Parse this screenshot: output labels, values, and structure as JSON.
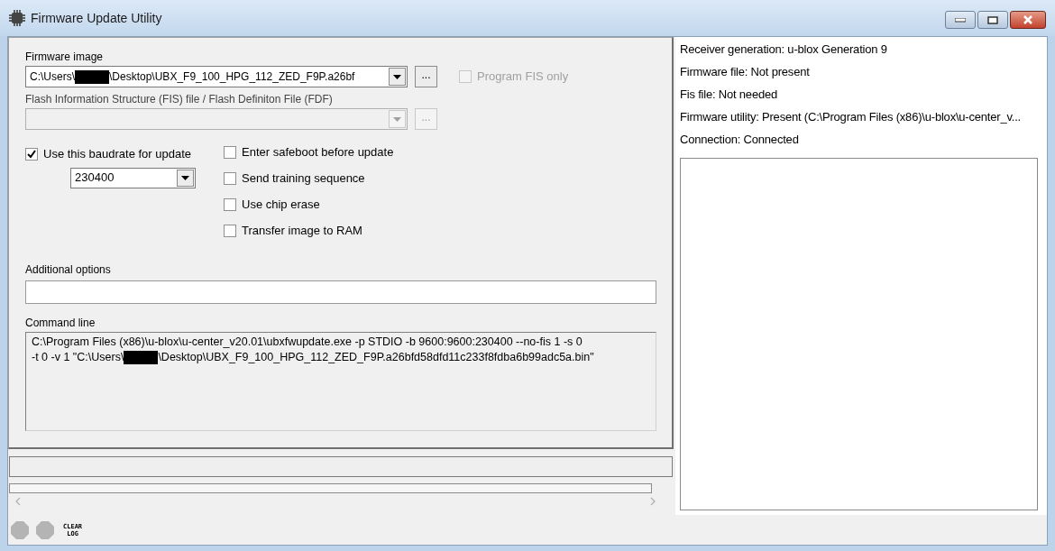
{
  "window": {
    "title": "Firmware Update Utility"
  },
  "firmware_image": {
    "label": "Firmware image",
    "value_parts": [
      "C:\\Users\\",
      "\\Desktop\\UBX_F9_100_HPG_112_ZED_F9P.a26bf"
    ],
    "browse": "..."
  },
  "program_fis_only": {
    "label": "Program FIS only",
    "checked": false,
    "disabled": true
  },
  "fis_file": {
    "label": "Flash Information Structure (FIS) file / Flash Definiton File (FDF)",
    "browse": "...",
    "disabled": true
  },
  "baudrate": {
    "label": "Use this baudrate for update",
    "checked": true,
    "value": "230400"
  },
  "options": [
    {
      "label": "Enter safeboot before update",
      "checked": false
    },
    {
      "label": "Send training sequence",
      "checked": false
    },
    {
      "label": "Use chip erase",
      "checked": false
    },
    {
      "label": "Transfer image to RAM",
      "checked": false
    }
  ],
  "additional_options": {
    "label": "Additional options"
  },
  "command_line": {
    "label": "Command line",
    "lines": [
      [
        "C:\\Program Files (x86)\\u-blox\\u-center_v20.01\\ubxfwupdate.exe -p STDIO -b 9600:9600:230400 --no-fis 1 -s 0"
      ],
      [
        "-t 0 -v 1 \"C:\\Users\\",
        "\\Desktop\\UBX_F9_100_HPG_112_ZED_F9P.a26bfd58dfd11c233f8fdba6b99adc5a.bin\""
      ]
    ]
  },
  "status": [
    "Receiver generation: u-blox Generation 9",
    "Firmware file: Not present",
    "Fis file: Not needed",
    "Firmware utility: Present (C:\\Program Files (x86)\\u-blox\\u-center_v...",
    "Connection: Connected"
  ],
  "toolbar": {
    "clear_log": [
      "CLEAR",
      "LOG"
    ]
  }
}
